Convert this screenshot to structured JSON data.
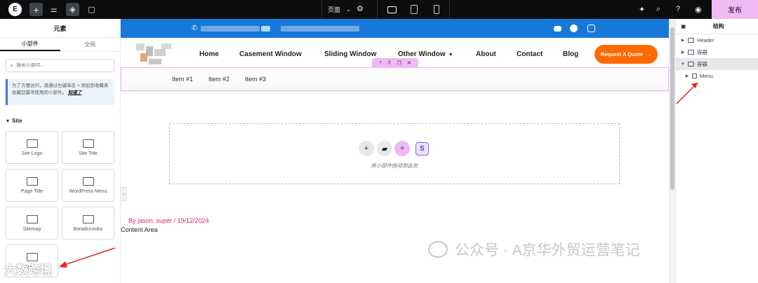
{
  "topbar": {
    "logo_icon": "elementor-logo-icon",
    "page_select": "页面",
    "publish_label": "发布",
    "accent_color": "#f0b8f5"
  },
  "left_panel": {
    "title": "元素",
    "tabs": [
      "小部件",
      "全局"
    ],
    "search_placeholder": "搜索小部件...",
    "notice_text": "为了方便访问，请通过右键单击 > 添加到收藏来收藏您最常使用的小部件。",
    "notice_link": "知道了",
    "section_title": "Site",
    "widgets": [
      {
        "label": "Site Logo",
        "icon": "site-logo-icon"
      },
      {
        "label": "Site Title",
        "icon": "site-title-icon"
      },
      {
        "label": "Page Title",
        "icon": "page-title-icon"
      },
      {
        "label": "WordPress Menu",
        "icon": "wordpress-menu-icon"
      },
      {
        "label": "Sitemap",
        "icon": "sitemap-icon"
      },
      {
        "label": "Breadcrumbs",
        "icon": "breadcrumbs-icon"
      },
      {
        "label": "Menu",
        "icon": "menu-icon"
      }
    ]
  },
  "site": {
    "nav": [
      "Home",
      "Casement Window",
      "Sliding Window",
      "Other Window",
      "About",
      "Contact",
      "Blog"
    ],
    "quote_button": "Request A Quote",
    "menu_items": [
      "Item #1",
      "Item #2",
      "Item #3"
    ],
    "drop_zone_text": "将小部件拖动到此处",
    "byline": "By jason, super / 19/12/2024",
    "content_area": "Content Area",
    "brand_orange": "#ff6a00",
    "topbar_blue": "#1679d8"
  },
  "watermark": {
    "text": "公众号 · A京华外贸运营笔记",
    "corner_text": "大数跨境"
  },
  "structure": {
    "title": "结构",
    "items": [
      {
        "label": "Header",
        "level": 0
      },
      {
        "label": "容器",
        "level": 0
      },
      {
        "label": "容器",
        "level": 0,
        "selected": true
      },
      {
        "label": "Menu",
        "level": 1
      }
    ]
  }
}
